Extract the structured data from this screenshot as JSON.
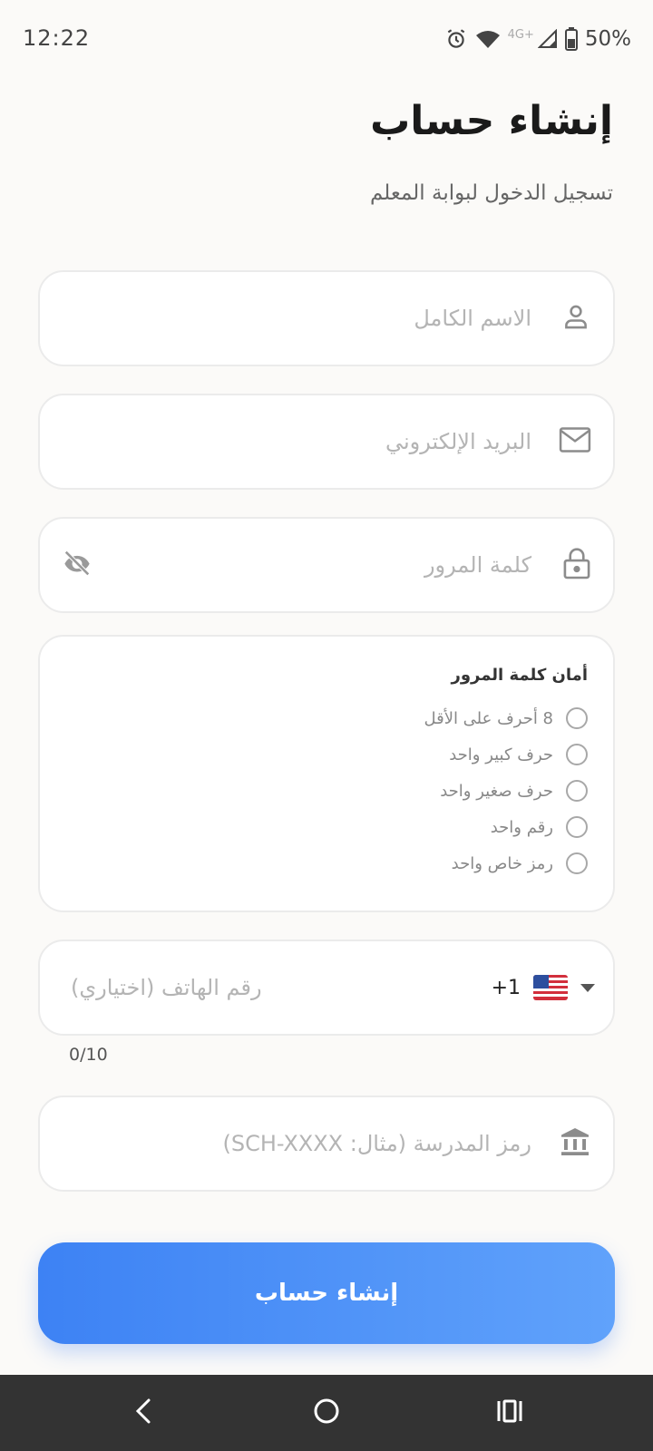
{
  "status": {
    "time": "12:22",
    "network_label": "4G+",
    "battery": "50%"
  },
  "header": {
    "title": "إنشاء حساب",
    "subtitle": "تسجيل الدخول لبوابة المعلم"
  },
  "form": {
    "full_name_placeholder": "الاسم الكامل",
    "email_placeholder": "البريد الإلكتروني",
    "password_placeholder": "كلمة المرور",
    "security": {
      "title": "أمان كلمة المرور",
      "requirements": [
        {
          "label": "8 أحرف على الأقل",
          "met": false
        },
        {
          "label": "حرف كبير واحد",
          "met": false
        },
        {
          "label": "حرف صغير واحد",
          "met": false
        },
        {
          "label": "رقم واحد",
          "met": false
        },
        {
          "label": "رمز خاص واحد",
          "met": false
        }
      ]
    },
    "phone": {
      "country_code": "+1",
      "placeholder": "رقم الهاتف (اختياري)",
      "counter": "0/10"
    },
    "school_code_placeholder": "رمز المدرسة (مثال: SCH-XXXX)",
    "submit_label": "إنشاء حساب"
  },
  "icons": {
    "name": "person-icon",
    "email": "envelope-icon",
    "password": "lock-icon",
    "toggle": "eye-off-icon",
    "school": "bank-icon"
  },
  "colors": {
    "accent_start": "#3d82f4",
    "accent_end": "#60a2fb",
    "background": "#fbfaf8"
  }
}
